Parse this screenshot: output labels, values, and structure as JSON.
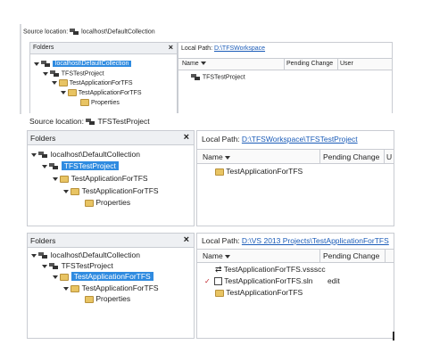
{
  "p1": {
    "source_label": "Source location:",
    "source_value": "localhost\\DefaultCollection",
    "folders_header": "Folders",
    "close": "×",
    "tree": [
      "localhost\\DefaultCollection",
      "TFSTestProject",
      "TestApplicationForTFS",
      "TestApplicationForTFS",
      "Properties"
    ],
    "local_path_label": "Local Path:",
    "local_path_value": "D:\\TFSWorkspace",
    "columns": [
      "Name",
      "Pending Change",
      "User"
    ],
    "files": [
      "TFSTestProject"
    ]
  },
  "p2": {
    "source_label": "Source location:",
    "source_value": "TFSTestProject",
    "folders_header": "Folders",
    "close": "×",
    "tree": [
      "localhost\\DefaultCollection",
      "TFSTestProject",
      "TestApplicationForTFS",
      "TestApplicationForTFS",
      "Properties"
    ],
    "local_path_label": "Local Path:",
    "local_path_value": "D:\\TFSWorkspace\\TFSTestProject",
    "columns": [
      "Name",
      "Pending Change",
      "U"
    ],
    "files": [
      "TestApplicationForTFS"
    ]
  },
  "p3": {
    "folders_header": "Folders",
    "close": "×",
    "tree": [
      "localhost\\DefaultCollection",
      "TFSTestProject",
      "TestApplicationForTFS",
      "TestApplicationForTFS",
      "Properties"
    ],
    "local_path_label": "Local Path:",
    "local_path_value": "D:\\VS 2013 Projects\\TestApplicationForTFS",
    "columns": [
      "Name",
      "Pending Change"
    ],
    "files": [
      {
        "name": "TestApplicationForTFS.vssscc",
        "change": ""
      },
      {
        "name": "TestApplicationForTFS.sln",
        "change": "edit"
      },
      {
        "name": "TestApplicationForTFS",
        "change": ""
      }
    ]
  }
}
